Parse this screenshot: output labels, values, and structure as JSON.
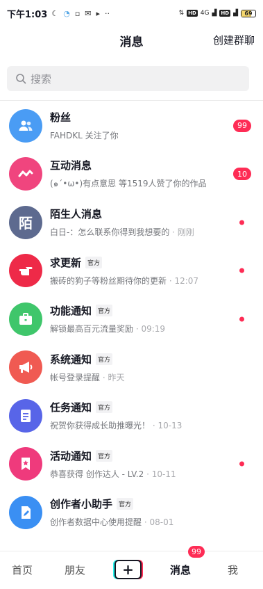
{
  "status_bar": {
    "time": "下午1:03",
    "network": "4G",
    "battery": "69"
  },
  "header": {
    "title": "消息",
    "action": "创建群聊"
  },
  "search": {
    "placeholder": "搜索"
  },
  "messages": [
    {
      "title": "粉丝",
      "tag": "",
      "subtitle": "FAHDKL 关注了你",
      "time": "",
      "badge": "99",
      "dot": false,
      "icon": "people-icon",
      "color": "#4a9cf4",
      "avatar_text": ""
    },
    {
      "title": "互动消息",
      "tag": "",
      "subtitle": "(๑´•ω•)有点意思 等1519人赞了你的作品",
      "time": "",
      "badge": "10",
      "dot": false,
      "icon": "wave-icon",
      "color": "#f0457e",
      "avatar_text": ""
    },
    {
      "title": "陌生人消息",
      "tag": "",
      "subtitle": "白日-：怎么联系你得到我想要的",
      "time": "刚刚",
      "badge": "",
      "dot": true,
      "icon": "",
      "color": "#5d6a8f",
      "avatar_text": "陌"
    },
    {
      "title": "求更新",
      "tag": "官方",
      "subtitle": "搬砖的狗子等粉丝期待你的更新",
      "time": "12:07",
      "badge": "",
      "dot": true,
      "icon": "pointing-hand-icon",
      "color": "#ee2a48",
      "avatar_text": ""
    },
    {
      "title": "功能通知",
      "tag": "官方",
      "subtitle": "解锁最高百元流量奖励",
      "time": "09:19",
      "badge": "",
      "dot": true,
      "icon": "briefcase-icon",
      "color": "#3fc66b",
      "avatar_text": ""
    },
    {
      "title": "系统通知",
      "tag": "官方",
      "subtitle": "帐号登录提醒",
      "time": "昨天",
      "badge": "",
      "dot": false,
      "icon": "megaphone-icon",
      "color": "#f05a52",
      "avatar_text": ""
    },
    {
      "title": "任务通知",
      "tag": "官方",
      "subtitle": "祝贺你获得成长助推曝光！",
      "time": "10-13",
      "badge": "",
      "dot": false,
      "icon": "document-icon",
      "color": "#5865e8",
      "avatar_text": ""
    },
    {
      "title": "活动通知",
      "tag": "官方",
      "subtitle": "恭喜获得 创作达人 - LV.2",
      "time": "10-11",
      "badge": "",
      "dot": true,
      "icon": "star-bookmark-icon",
      "color": "#ef3a7c",
      "avatar_text": ""
    },
    {
      "title": "创作者小助手",
      "tag": "官方",
      "subtitle": "创作者数据中心使用提醒",
      "time": "08-01",
      "badge": "",
      "dot": false,
      "icon": "edit-doc-icon",
      "color": "#3a8ff3",
      "avatar_text": ""
    }
  ],
  "bottom_nav": {
    "home": "首页",
    "friends": "朋友",
    "plus": "+",
    "messages": "消息",
    "messages_badge": "99",
    "me": "我"
  },
  "colors": {
    "accent": "#fe2c55"
  }
}
